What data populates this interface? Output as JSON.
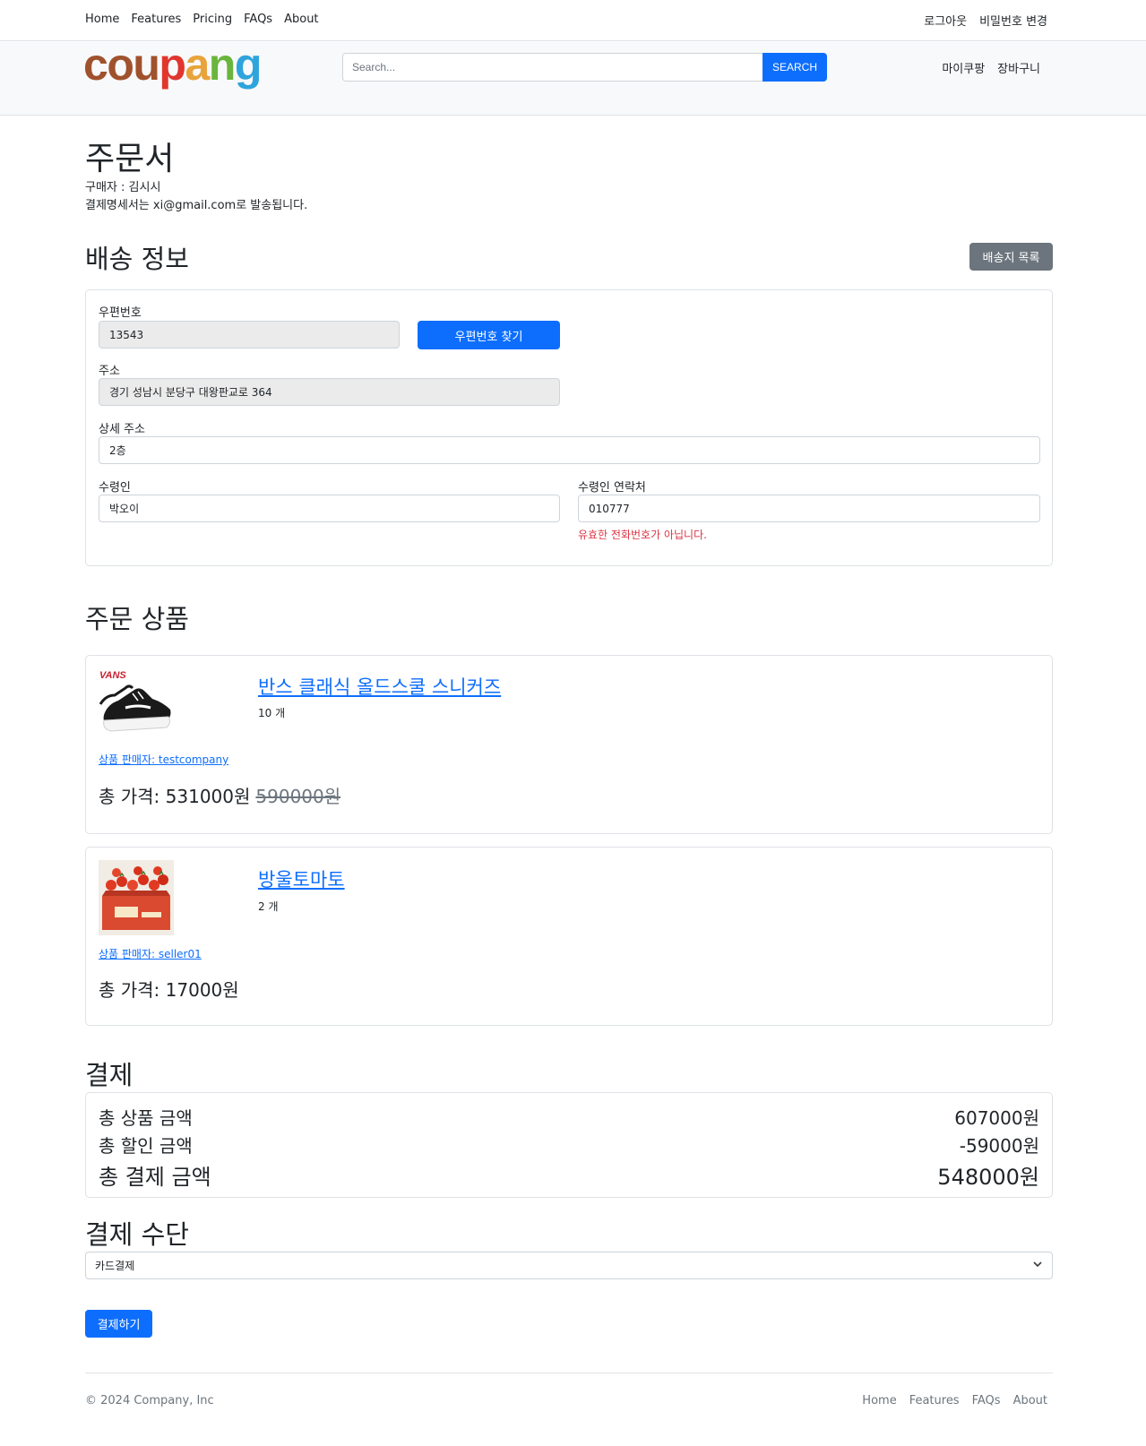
{
  "topnav": {
    "links": [
      "Home",
      "Features",
      "Pricing",
      "FAQs",
      "About"
    ],
    "logout": "로그아웃",
    "change_password": "비밀번호 변경"
  },
  "header": {
    "logo": {
      "c": "c",
      "o": "o",
      "u": "u",
      "p": "p",
      "a": "a",
      "n": "n",
      "g": "g"
    },
    "search_placeholder": "Search...",
    "search_label": "SEARCH",
    "mypage": "마이쿠팡",
    "cart": "장바구니"
  },
  "order": {
    "title": "주문서",
    "buyer": "구매자 : 김시시",
    "receipt": "결제명세서는 xi@gmail.com로 발송됩니다."
  },
  "shipping": {
    "title": "배송 정보",
    "address_list_label": "배송지 목록",
    "postcode_label": "우편번호",
    "postcode_value": "13543",
    "find_postcode_label": "우편번호 찾기",
    "address_label": "주소",
    "address_value": "경기 성남시 분당구 대왕판교로 364",
    "detail_label": "상세 주소",
    "detail_value": "2층",
    "recipient_label": "수령인",
    "recipient_value": "박오이",
    "phone_label": "수령인 연락처",
    "phone_value": "010777",
    "phone_error": "유효한 전화번호가 아닙니다."
  },
  "products": {
    "title": "주문 상품",
    "items": [
      {
        "name": "반스 클래식 올드스쿨 스니커즈",
        "quantity": "10 개",
        "seller": "상품 판매자: testcompany",
        "price_prefix": "총 가격: ",
        "price": "531000원",
        "original_price": "590000원",
        "image_brand": "VANS"
      },
      {
        "name": "방울토마토",
        "quantity": "2 개",
        "seller": "상품 판매자: seller01",
        "price_prefix": "총 가격: ",
        "price": "17000원",
        "original_price": ""
      }
    ]
  },
  "payment": {
    "title": "결제",
    "rows": [
      {
        "label": "총 상품 금액",
        "value": "607000원"
      },
      {
        "label": "총 할인 금액",
        "value": "-59000원"
      },
      {
        "label": "총 결제 금액",
        "value": "548000원"
      }
    ]
  },
  "method": {
    "title": "결제 수단",
    "selected": "카드결제",
    "submit_label": "결제하기"
  },
  "footer": {
    "copyright": "© 2024 Company, Inc",
    "links": [
      "Home",
      "Features",
      "FAQs",
      "About"
    ]
  },
  "colors": {
    "primary": "#0d6efd",
    "secondary": "#6c757d",
    "danger": "#dc3545"
  }
}
